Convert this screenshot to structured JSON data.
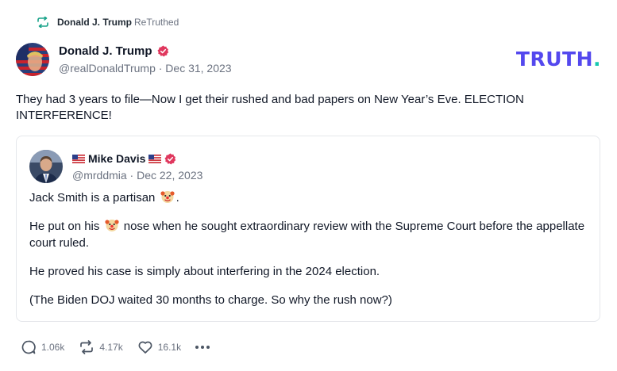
{
  "retruth": {
    "icon": "retruth-icon",
    "user_name": "Donald J. Trump",
    "label": "ReTruthed"
  },
  "post": {
    "author_name": "Donald J. Trump",
    "handle": "@realDonaldTrump",
    "date": "Dec 31, 2023",
    "meta": "@realDonaldTrump · Dec 31, 2023",
    "text": "They had 3 years to file—Now I get their rushed and bad papers on New Year’s Eve. ELECTION INTERFERENCE!"
  },
  "logo": {
    "text": "TRUTH",
    "dot": ".",
    "color": "#5448ee",
    "dot_color": "#17c8b0"
  },
  "quote": {
    "author_name": "Mike Davis",
    "meta": "@mrddmia · Dec 22, 2023",
    "line1_before": "Jack Smith is a partisan ",
    "line1_after": ".",
    "line2_before": "He put on his ",
    "line2_after": " nose when he sought extraordinary review with the Supreme Court before the appellate court ruled.",
    "line3": "He proved his case is simply about interfering in the 2024 election.",
    "line4": "(The Biden DOJ waited 30 months to charge. So why the rush now?)"
  },
  "actions": {
    "replies": "1.06k",
    "retruths": "4.17k",
    "likes": "16.1k"
  },
  "colors": {
    "verified": "#e0385e",
    "accent": "#5448ee",
    "muted": "#6b7280"
  }
}
